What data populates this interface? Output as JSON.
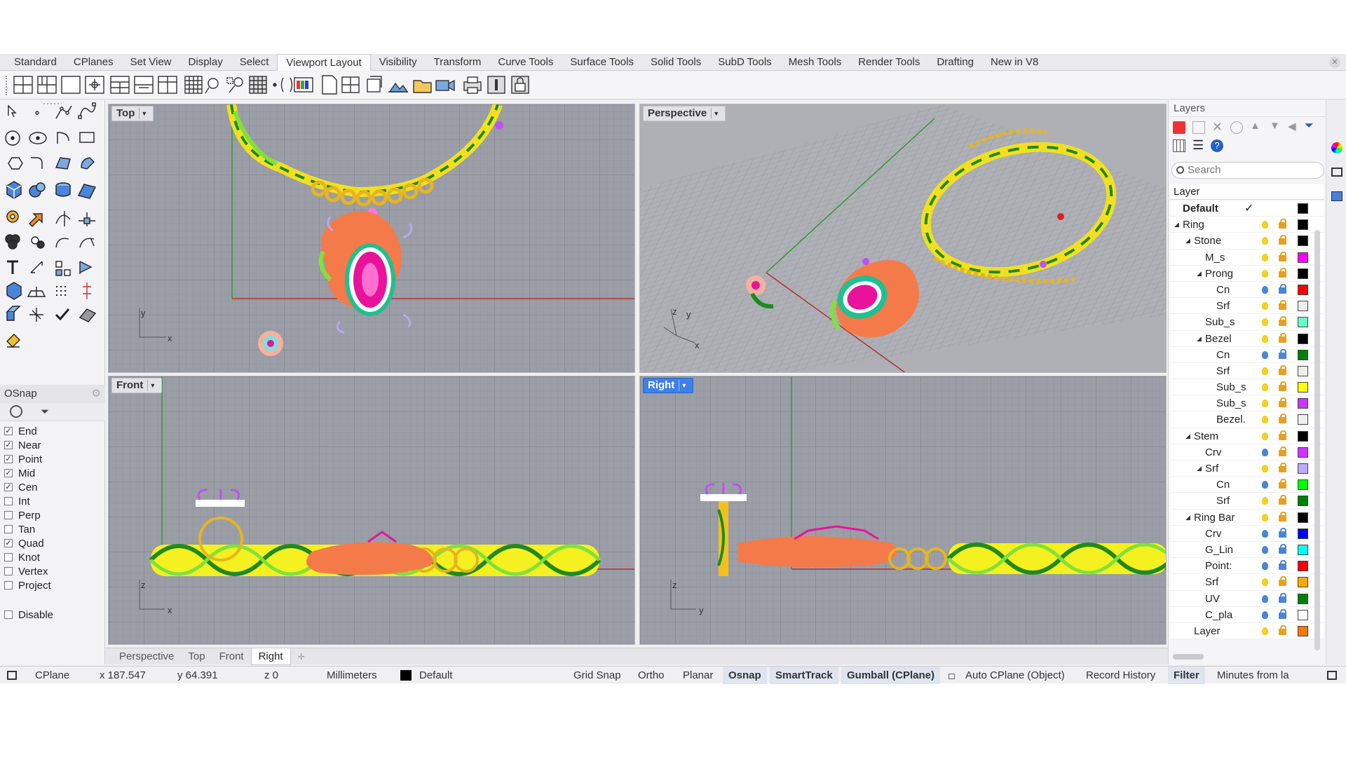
{
  "menu_tabs": [
    "Standard",
    "CPlanes",
    "Set View",
    "Display",
    "Select",
    "Viewport Layout",
    "Visibility",
    "Transform",
    "Curve Tools",
    "Surface Tools",
    "Solid Tools",
    "SubD Tools",
    "Mesh Tools",
    "Render Tools",
    "Drafting",
    "New in V8"
  ],
  "active_tab": "Viewport Layout",
  "viewports": {
    "top": {
      "label": "Top"
    },
    "perspective": {
      "label": "Perspective"
    },
    "front": {
      "label": "Front"
    },
    "right": {
      "label": "Right"
    }
  },
  "axis_labels": {
    "x": "x",
    "y": "y",
    "z": "z"
  },
  "viewport_tabs": [
    "Perspective",
    "Top",
    "Front",
    "Right"
  ],
  "active_viewport_tab": "Right",
  "osnap": {
    "title": "OSnap",
    "items": [
      {
        "label": "End",
        "checked": true
      },
      {
        "label": "Near",
        "checked": true
      },
      {
        "label": "Point",
        "checked": true
      },
      {
        "label": "Mid",
        "checked": true
      },
      {
        "label": "Cen",
        "checked": true
      },
      {
        "label": "Int",
        "checked": false
      },
      {
        "label": "Perp",
        "checked": false
      },
      {
        "label": "Tan",
        "checked": false
      },
      {
        "label": "Quad",
        "checked": true
      },
      {
        "label": "Knot",
        "checked": false
      },
      {
        "label": "Vertex",
        "checked": false
      },
      {
        "label": "Project",
        "checked": false
      }
    ],
    "disable_label": "Disable"
  },
  "layers": {
    "title": "Layers",
    "search_placeholder": "Search",
    "column_header": "Layer",
    "rows": [
      {
        "name": "Default",
        "depth": 0,
        "expander": false,
        "current": true,
        "color": "#000000",
        "bulb": "current",
        "lock": "none"
      },
      {
        "name": "Ring",
        "depth": 0,
        "expander": true,
        "color": "#000000",
        "bulb": "yellow",
        "lock": "open"
      },
      {
        "name": "Stone",
        "depth": 1,
        "expander": true,
        "color": "#000000",
        "bulb": "yellow",
        "lock": "open"
      },
      {
        "name": "M_s",
        "depth": 2,
        "expander": false,
        "color": "#ff00ff",
        "bulb": "yellow",
        "lock": "open"
      },
      {
        "name": "Prong",
        "depth": 2,
        "expander": true,
        "color": "#000000",
        "bulb": "yellow",
        "lock": "open"
      },
      {
        "name": "Cn",
        "depth": 3,
        "expander": false,
        "color": "#ff0000",
        "bulb": "blue",
        "lock": "closed"
      },
      {
        "name": "Srf",
        "depth": 3,
        "expander": false,
        "color": "#eeeeee",
        "bulb": "yellow",
        "lock": "open"
      },
      {
        "name": "Sub_s",
        "depth": 2,
        "expander": false,
        "color": "#66ffcc",
        "bulb": "yellow",
        "lock": "open"
      },
      {
        "name": "Bezel",
        "depth": 2,
        "expander": true,
        "color": "#000000",
        "bulb": "yellow",
        "lock": "open"
      },
      {
        "name": "Cn",
        "depth": 3,
        "expander": false,
        "color": "#008000",
        "bulb": "blue",
        "lock": "closed"
      },
      {
        "name": "Srf",
        "depth": 3,
        "expander": false,
        "color": "#eeeeee",
        "bulb": "yellow",
        "lock": "open"
      },
      {
        "name": "Sub_s",
        "depth": 3,
        "expander": false,
        "color": "#ffff00",
        "bulb": "yellow",
        "lock": "open"
      },
      {
        "name": "Sub_s",
        "depth": 3,
        "expander": false,
        "color": "#cc33ff",
        "bulb": "yellow",
        "lock": "open"
      },
      {
        "name": "Bezel.",
        "depth": 3,
        "expander": false,
        "color": "#eeeeee",
        "bulb": "yellow",
        "lock": "open"
      },
      {
        "name": "Stem",
        "depth": 1,
        "expander": true,
        "color": "#000000",
        "bulb": "yellow",
        "lock": "open"
      },
      {
        "name": "Crv",
        "depth": 2,
        "expander": false,
        "color": "#cc33ff",
        "bulb": "blue",
        "lock": "open"
      },
      {
        "name": "Srf",
        "depth": 2,
        "expander": true,
        "color": "#bbaaff",
        "bulb": "yellow",
        "lock": "open"
      },
      {
        "name": "Cn",
        "depth": 3,
        "expander": false,
        "color": "#00ff00",
        "bulb": "blue",
        "lock": "open"
      },
      {
        "name": "Srf",
        "depth": 3,
        "expander": false,
        "color": "#008000",
        "bulb": "yellow",
        "lock": "open"
      },
      {
        "name": "Ring Bar",
        "depth": 1,
        "expander": true,
        "color": "#000000",
        "bulb": "yellow",
        "lock": "open"
      },
      {
        "name": "Crv",
        "depth": 2,
        "expander": false,
        "color": "#0000ff",
        "bulb": "blue",
        "lock": "closed"
      },
      {
        "name": "G_Lin",
        "depth": 2,
        "expander": false,
        "color": "#00ffff",
        "bulb": "blue",
        "lock": "closed"
      },
      {
        "name": "Point:",
        "depth": 2,
        "expander": false,
        "color": "#ff0000",
        "bulb": "blue",
        "lock": "closed"
      },
      {
        "name": "Srf",
        "depth": 2,
        "expander": false,
        "color": "#ffaa00",
        "bulb": "yellow",
        "lock": "open"
      },
      {
        "name": "UV",
        "depth": 2,
        "expander": false,
        "color": "#008000",
        "bulb": "blue",
        "lock": "closed"
      },
      {
        "name": "C_pla",
        "depth": 2,
        "expander": false,
        "color": "#ffffff",
        "bulb": "blue",
        "lock": "closed"
      },
      {
        "name": "Layer",
        "depth": 1,
        "expander": false,
        "color": "#ff7700",
        "bulb": "yellow",
        "lock": "open"
      }
    ]
  },
  "status": {
    "cplane": "CPlane",
    "x": "x 187.547",
    "y": "y 64.391",
    "z": "z 0",
    "units": "Millimeters",
    "layer": "Default",
    "layer_color": "#000000",
    "grid_snap": "Grid Snap",
    "ortho": "Ortho",
    "planar": "Planar",
    "osnap": "Osnap",
    "smarttrack": "SmartTrack",
    "gumball": "Gumball (CPlane)",
    "auto_cplane": "Auto CPlane (Object)",
    "record_history": "Record History",
    "filter": "Filter",
    "minutes": "Minutes from la"
  },
  "colors": {
    "accent": "#3f7fe8",
    "viewport_bg": "#9b9ea6",
    "gold": "#f2c21a",
    "yellow": "#f5f020",
    "green": "#1f8a1f",
    "lime": "#7fe23a",
    "coral": "#f57a4a",
    "pink": "#e8139a",
    "lavender": "#b6a8f0",
    "teal": "#18c29a"
  }
}
